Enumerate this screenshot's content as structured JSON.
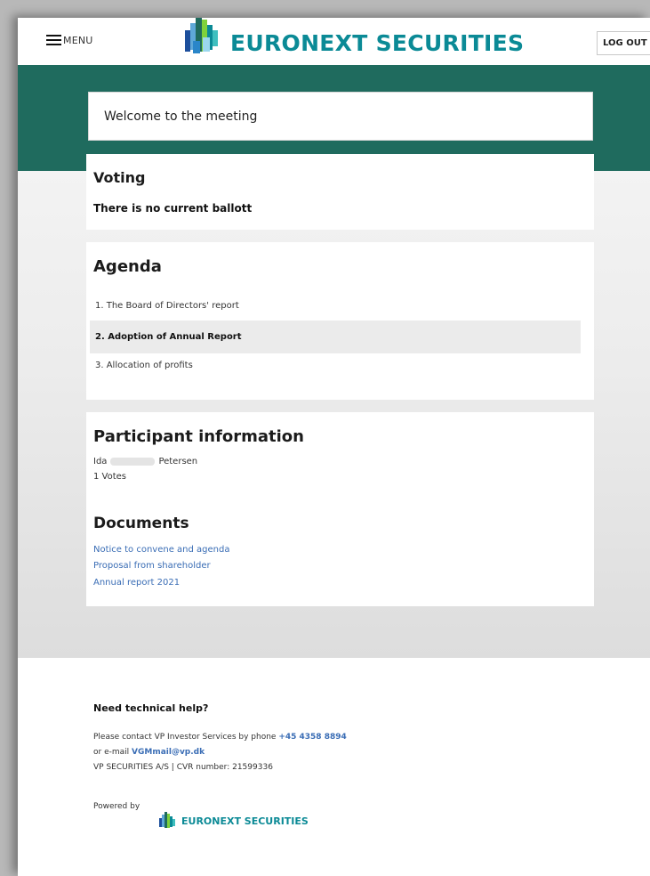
{
  "header": {
    "menu_label": "MENU",
    "brand": "EURONEXT SECURITIES",
    "logout_label": "LOG OUT"
  },
  "welcome": {
    "text": "Welcome to the meeting"
  },
  "voting": {
    "title": "Voting",
    "message": "There is no current ballott"
  },
  "agenda": {
    "title": "Agenda",
    "items": [
      {
        "label": "1. The Board of Directors' report"
      },
      {
        "label": "2. Adoption of Annual Report"
      },
      {
        "label": "3. Allocation of profits"
      }
    ]
  },
  "participant": {
    "title": "Participant information",
    "first_name": "Ida",
    "last_name": "Petersen",
    "votes": "1 Votes"
  },
  "documents": {
    "title": "Documents",
    "links": [
      {
        "label": "Notice to convene and agenda"
      },
      {
        "label": "Proposal from shareholder"
      },
      {
        "label": "Annual report 2021"
      }
    ]
  },
  "footer": {
    "help_title": "Need technical help?",
    "contact_prefix": "Please contact VP Investor Services by phone",
    "phone": "+45 4358 8894",
    "email_prefix": "or e-mail",
    "email": "VGMmail@vp.dk",
    "company_line": "VP SECURITIES A/S | CVR number: 21599336",
    "powered_by": "Powered by",
    "brand": "EURONEXT SECURITIES"
  },
  "colors": {
    "brand_teal": "#0b8a96",
    "header_band": "#1f6b5e",
    "link": "#3a6db5"
  }
}
